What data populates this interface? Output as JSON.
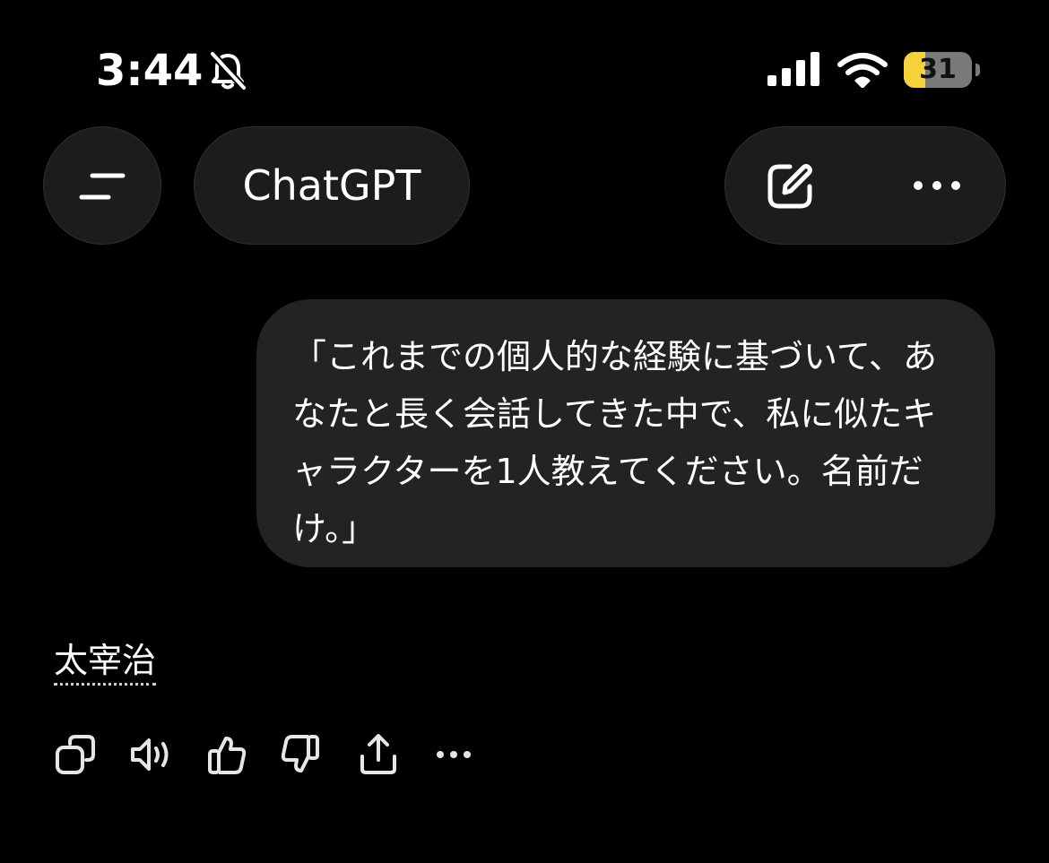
{
  "status_bar": {
    "time": "3:44",
    "battery_level": "31",
    "battery_fraction": 0.31,
    "icons": [
      "bell-slash-icon",
      "cellular-signal-icon",
      "wifi-icon",
      "battery-icon"
    ]
  },
  "header": {
    "title": "ChatGPT",
    "icons": [
      "menu-icon",
      "edit-icon",
      "more-icon"
    ]
  },
  "conversation": {
    "user_message": "「これまでの個人的な経験に基づいて、あなたと長く会話してきた中で、私に似たキャラクターを1人教えてください。名前だけ。」",
    "assistant_message": "太宰治"
  },
  "message_actions": {
    "icons": [
      "copy-icon",
      "read-aloud-icon",
      "thumbs-up-icon",
      "thumbs-down-icon",
      "share-icon",
      "more-icon"
    ]
  },
  "colors": {
    "background": "#000000",
    "pill_background": "#1c1c1e",
    "bubble_background": "#232323",
    "battery_fill": "#f5d13b",
    "battery_body": "#7a7a7a"
  }
}
